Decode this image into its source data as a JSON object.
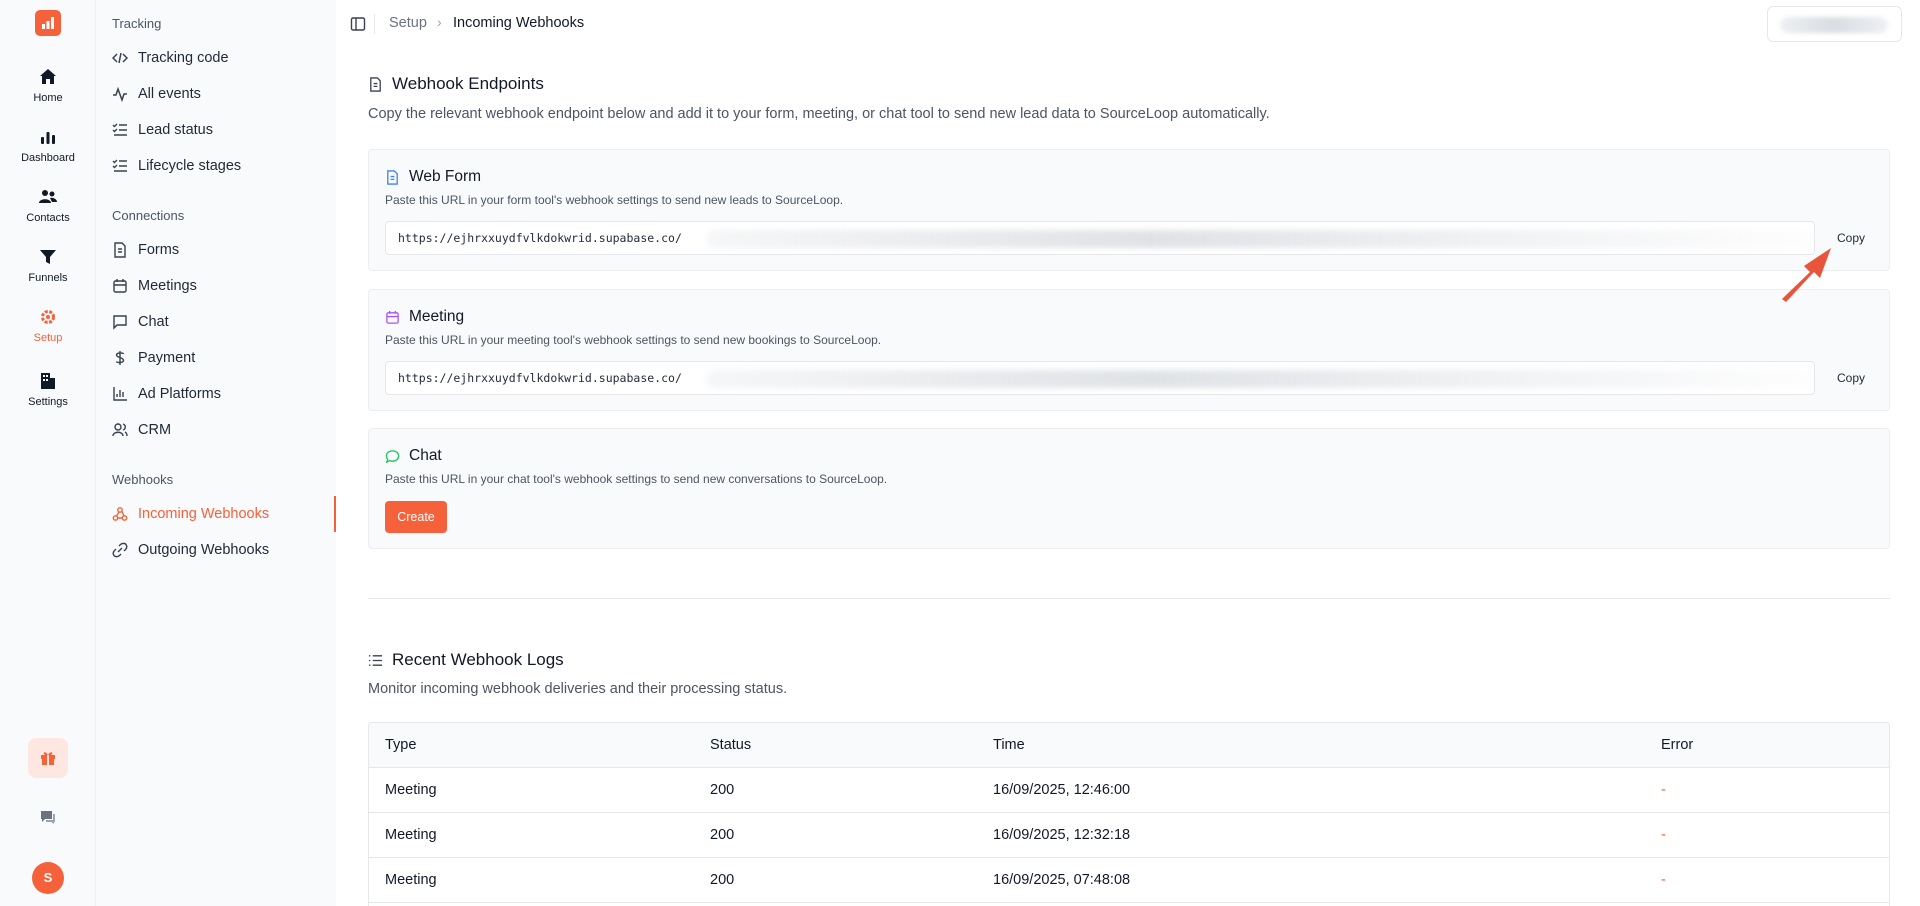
{
  "rail": {
    "items": [
      {
        "label": "Home",
        "icon": "home-icon"
      },
      {
        "label": "Dashboard",
        "icon": "bar-chart-icon"
      },
      {
        "label": "Contacts",
        "icon": "users-icon"
      },
      {
        "label": "Funnels",
        "icon": "funnel-icon"
      },
      {
        "label": "Setup",
        "icon": "gear-icon"
      },
      {
        "label": "Settings",
        "icon": "building-icon"
      }
    ],
    "active": "Setup",
    "avatar": "S"
  },
  "subnav": {
    "tracking_title": "Tracking",
    "tracking": [
      {
        "label": "Tracking code",
        "icon": "code-icon"
      },
      {
        "label": "All events",
        "icon": "activity-icon"
      },
      {
        "label": "Lead status",
        "icon": "list-check-icon"
      },
      {
        "label": "Lifecycle stages",
        "icon": "list-check-icon"
      }
    ],
    "connections_title": "Connections",
    "connections": [
      {
        "label": "Forms",
        "icon": "file-icon"
      },
      {
        "label": "Meetings",
        "icon": "calendar-icon"
      },
      {
        "label": "Chat",
        "icon": "message-square-icon"
      },
      {
        "label": "Payment",
        "icon": "dollar-icon"
      },
      {
        "label": "Ad Platforms",
        "icon": "bar-chart-icon"
      },
      {
        "label": "CRM",
        "icon": "users-icon"
      }
    ],
    "webhooks_title": "Webhooks",
    "webhooks": [
      {
        "label": "Incoming Webhooks",
        "icon": "webhook-icon",
        "active": true
      },
      {
        "label": "Outgoing Webhooks",
        "icon": "link-icon",
        "active": false
      }
    ]
  },
  "header": {
    "crumb_parent": "Setup",
    "crumb_sep": "›",
    "crumb_current": "Incoming Webhooks"
  },
  "endpoints": {
    "title": "Webhook Endpoints",
    "description": "Copy the relevant webhook endpoint below and add it to your form, meeting, or chat tool to send new lead data to SourceLoop automatically.",
    "web_form": {
      "title": "Web Form",
      "description": "Paste this URL in your form tool's webhook settings to send new leads to SourceLoop.",
      "url": "https://ejhrxxuydfvlkdokwrid.supabase.co/",
      "copy_label": "Copy"
    },
    "meeting": {
      "title": "Meeting",
      "description": "Paste this URL in your meeting tool's webhook settings to send new bookings to SourceLoop.",
      "url": "https://ejhrxxuydfvlkdokwrid.supabase.co/",
      "copy_label": "Copy"
    },
    "chat": {
      "title": "Chat",
      "description": "Paste this URL in your chat tool's webhook settings to send new conversations to SourceLoop.",
      "create_label": "Create"
    }
  },
  "logs": {
    "title": "Recent Webhook Logs",
    "description": "Monitor incoming webhook deliveries and their processing status.",
    "columns": [
      "Type",
      "Status",
      "Time",
      "Error"
    ],
    "rows": [
      [
        "Meeting",
        "200",
        "16/09/2025, 12:46:00",
        "-"
      ],
      [
        "Meeting",
        "200",
        "16/09/2025, 12:32:18",
        "-"
      ],
      [
        "Meeting",
        "200",
        "16/09/2025, 07:48:08",
        "-"
      ]
    ]
  },
  "colors": {
    "accent": "#f4613a",
    "card_bg": "#f9fafb",
    "border": "#e5e7eb"
  }
}
